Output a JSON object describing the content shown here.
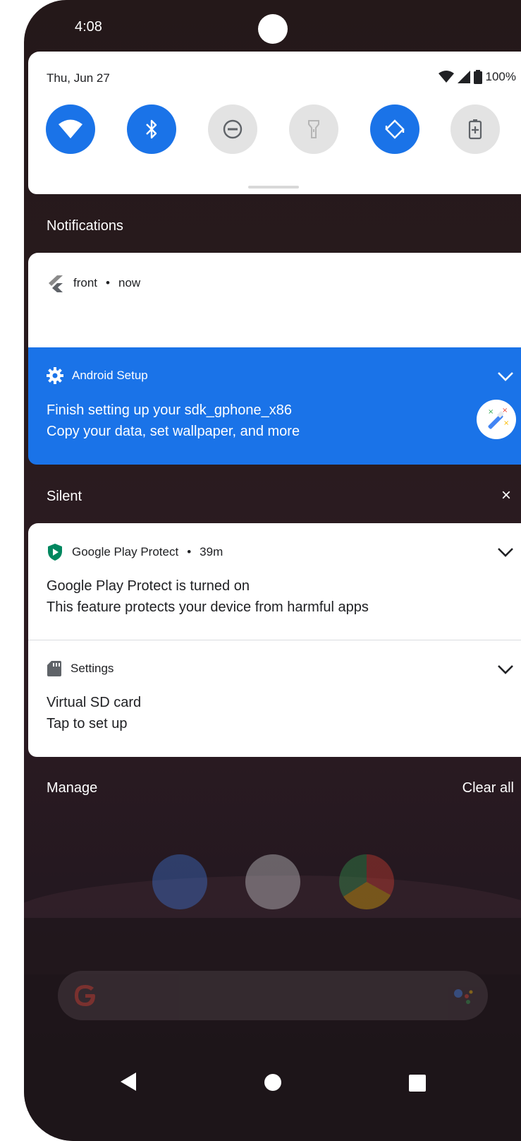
{
  "status_bar": {
    "time": "4:08"
  },
  "quick_settings": {
    "date": "Thu, Jun 27",
    "battery": "100%",
    "tiles": [
      {
        "name": "wifi",
        "state": "on"
      },
      {
        "name": "bluetooth",
        "state": "on"
      },
      {
        "name": "do-not-disturb",
        "state": "off"
      },
      {
        "name": "flashlight",
        "state": "off"
      },
      {
        "name": "auto-rotate",
        "state": "on"
      },
      {
        "name": "battery-saver",
        "state": "off"
      }
    ]
  },
  "notifications": {
    "title": "Notifications",
    "front": {
      "app": "front",
      "time": "now"
    },
    "android_setup": {
      "app": "Android Setup",
      "line1": "Finish setting up your sdk_gphone_x86",
      "line2": "Copy your data, set wallpaper, and more"
    }
  },
  "silent": {
    "title": "Silent",
    "close": "×",
    "play_protect": {
      "app": "Google Play Protect",
      "time": "39m",
      "line1": "Google Play Protect is turned on",
      "line2": "This feature protects your device from harmful apps"
    },
    "settings": {
      "app": "Settings",
      "line1": "Virtual SD card",
      "line2": "Tap to set up"
    }
  },
  "footer": {
    "manage": "Manage",
    "clear_all": "Clear all"
  },
  "colors": {
    "accent": "#1a73e8",
    "play_protect": "#01875f"
  }
}
